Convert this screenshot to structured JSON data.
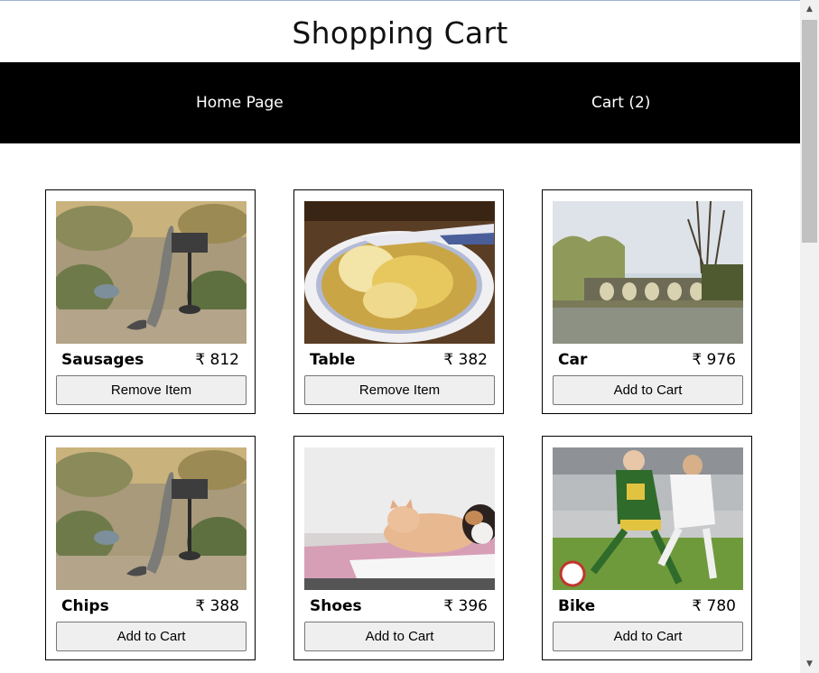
{
  "header": {
    "title": "Shopping Cart"
  },
  "nav": {
    "home_label": "Home Page",
    "cart_label": "Cart (2)"
  },
  "products": [
    {
      "name": "Sausages",
      "price": "₹ 812",
      "button": "Remove Item",
      "image_icon": "fox-photo"
    },
    {
      "name": "Table",
      "price": "₹ 382",
      "button": "Remove Item",
      "image_icon": "noodle-soup-photo"
    },
    {
      "name": "Car",
      "price": "₹ 976",
      "button": "Add to Cart",
      "image_icon": "bridge-landscape-photo"
    },
    {
      "name": "Chips",
      "price": "₹ 388",
      "button": "Add to Cart",
      "image_icon": "fox-photo"
    },
    {
      "name": "Shoes",
      "price": "₹ 396",
      "button": "Add to Cart",
      "image_icon": "cats-photo"
    },
    {
      "name": "Bike",
      "price": "₹ 780",
      "button": "Add to Cart",
      "image_icon": "soccer-players-photo"
    }
  ],
  "scrollbar": {
    "up_icon": "▲",
    "down_icon": "▼"
  },
  "colors": {
    "navbar": "#000000",
    "nav_text": "#ffffff",
    "button_bg": "#efefef",
    "button_border": "#767676"
  }
}
